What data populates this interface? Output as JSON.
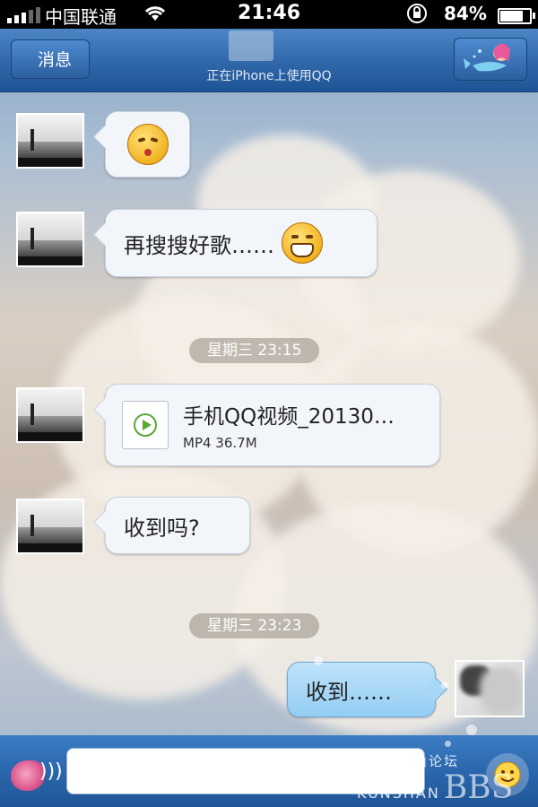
{
  "status_bar": {
    "carrier": "中国联通",
    "time": "21:46",
    "battery_percent": "84%",
    "battery_level": 0.84
  },
  "nav": {
    "back_label": "消息",
    "subtitle": "正在iPhone上使用QQ"
  },
  "messages": [
    {
      "side": "left",
      "kind": "emoji",
      "emoji": "kiss-face-emoji"
    },
    {
      "side": "left",
      "kind": "text",
      "text": "再搜搜好歌……",
      "emoji": "grin-face-emoji"
    },
    {
      "kind": "timestamp",
      "text": "星期三 23:15"
    },
    {
      "side": "left",
      "kind": "file",
      "file_name": "手机QQ视频_20130…",
      "file_meta": "MP4  36.7M",
      "icon": "video-file-icon"
    },
    {
      "side": "left",
      "kind": "text",
      "text": "收到吗?"
    },
    {
      "kind": "timestamp",
      "text": "星期三 23:23"
    },
    {
      "side": "right",
      "kind": "text",
      "text": "收到……"
    }
  ],
  "input": {
    "placeholder": ""
  },
  "watermark": {
    "cn": "昆山论坛",
    "en": "KUNSHAN",
    "bbs": "BBS"
  }
}
